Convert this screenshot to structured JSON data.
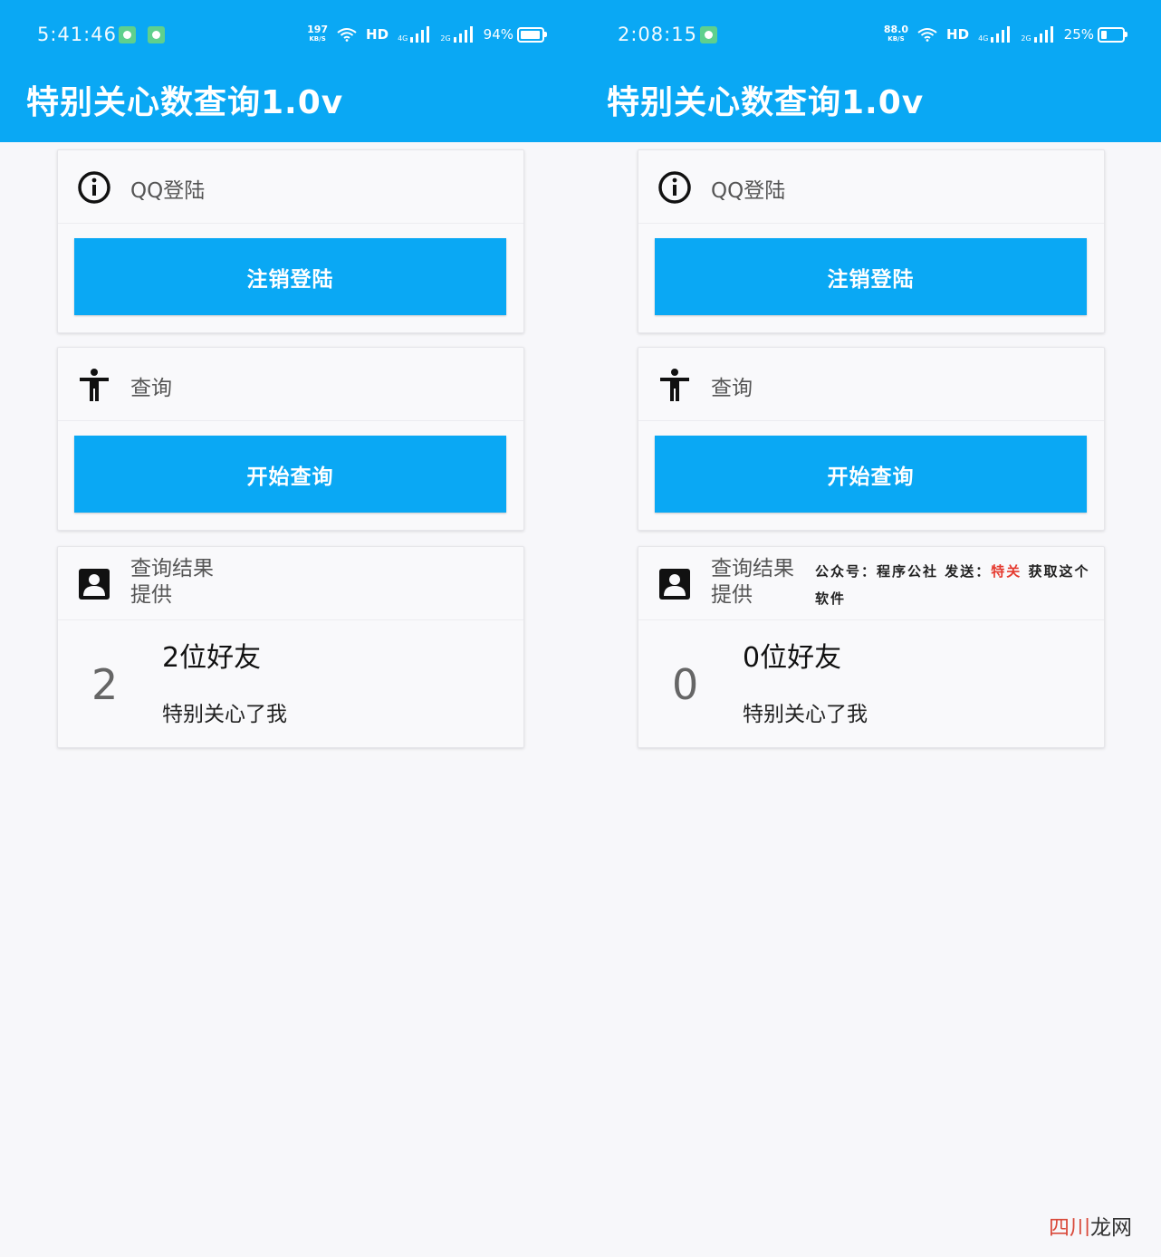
{
  "screens": [
    {
      "status": {
        "time": "5:41:46",
        "netspeed_top": "197",
        "netspeed_unit": "KB/S",
        "hd": "HD",
        "signal1": "4G",
        "signal2": "2G",
        "battery": "94%",
        "battery_level": 0.94
      },
      "app_title": "特别关心数查询1.0v",
      "login_card": {
        "label": "QQ登陆",
        "button": "注销登陆"
      },
      "query_card": {
        "label": "查询",
        "button": "开始查询"
      },
      "result_card": {
        "label_line1": "查询结果",
        "label_line2": "提供",
        "count": "2",
        "friends": "2位好友",
        "sub": "特别关心了我"
      }
    },
    {
      "status": {
        "time": "2:08:15",
        "netspeed_top": "88.0",
        "netspeed_unit": "KB/S",
        "hd": "HD",
        "signal1": "4G",
        "signal2": "2G",
        "battery": "25%",
        "battery_level": 0.25
      },
      "app_title": "特别关心数查询1.0v",
      "login_card": {
        "label": "QQ登陆",
        "button": "注销登陆"
      },
      "query_card": {
        "label": "查询",
        "button": "开始查询"
      },
      "result_card": {
        "label_line1": "查询结果",
        "label_line2": "提供",
        "count": "0",
        "friends": "0位好友",
        "sub": "特别关心了我",
        "notice_a": "公众号：程序公社 发送：",
        "notice_highlight": "特关",
        "notice_b": " 获取这个软件"
      }
    }
  ],
  "watermark": {
    "part1": "四川",
    "part2": "龙网"
  },
  "colors": {
    "accent": "#0aa8f4",
    "background": "#f7f7fa",
    "highlight": "#e53a2f"
  }
}
